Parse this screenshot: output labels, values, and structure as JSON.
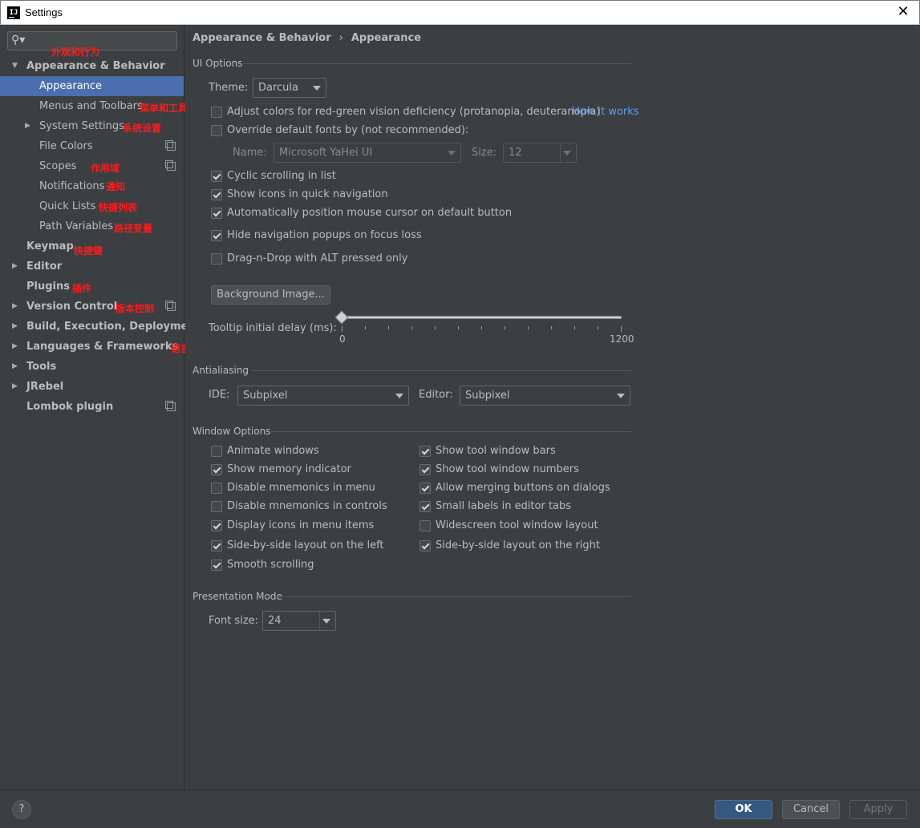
{
  "window": {
    "title": "Settings",
    "app_icon": "IJ"
  },
  "sidebar": {
    "search": {
      "placeholder": "",
      "value": ""
    },
    "items": [
      {
        "label": "Appearance & Behavior",
        "annotation": "外观和行为"
      },
      {
        "label": "Appearance",
        "annotation": ""
      },
      {
        "label": "Menus and Toolbars",
        "annotation": "菜单和工具栏"
      },
      {
        "label": "System Settings",
        "annotation": "系统设置"
      },
      {
        "label": "File Colors",
        "annotation": ""
      },
      {
        "label": "Scopes",
        "annotation": "作用域"
      },
      {
        "label": "Notifications",
        "annotation": "通知"
      },
      {
        "label": "Quick Lists",
        "annotation": "快捷列表"
      },
      {
        "label": "Path Variables",
        "annotation": "路径变量"
      },
      {
        "label": "Keymap",
        "annotation": "快捷键"
      },
      {
        "label": "Editor",
        "annotation": ""
      },
      {
        "label": "Plugins",
        "annotation": "插件"
      },
      {
        "label": "Version Control",
        "annotation": "版本控制"
      },
      {
        "label": "Build, Execution, Deployment",
        "annotation": ""
      },
      {
        "label": "Languages & Frameworks",
        "annotation": "语言和框架"
      },
      {
        "label": "Tools",
        "annotation": ""
      },
      {
        "label": "JRebel",
        "annotation": ""
      },
      {
        "label": "Lombok plugin",
        "annotation": ""
      }
    ]
  },
  "breadcrumb": {
    "parent": "Appearance & Behavior",
    "separator": "›",
    "current": "Appearance"
  },
  "ui_options": {
    "title": "UI Options",
    "theme_label": "Theme:",
    "theme_value": "Darcula",
    "adjust_colors": {
      "label": "Adjust colors for red-green vision deficiency (protanopia, deuteranopia)",
      "checked": false
    },
    "how_it_works": "How it works",
    "override_fonts": {
      "label": "Override default fonts by (not recommended):",
      "checked": false
    },
    "name_label": "Name:",
    "name_value": "Microsoft YaHei UI",
    "size_label": "Size:",
    "size_value": "12",
    "cyclic_scrolling": {
      "label": "Cyclic scrolling in list",
      "checked": true
    },
    "show_icons_quick_nav": {
      "label": "Show icons in quick navigation",
      "checked": true
    },
    "auto_position_cursor": {
      "label": "Automatically position mouse cursor on default button",
      "checked": true
    },
    "hide_nav_popups": {
      "label": "Hide navigation popups on focus loss",
      "checked": true
    },
    "drag_n_drop_alt": {
      "label": "Drag-n-Drop with ALT pressed only",
      "checked": false
    },
    "background_image_button": "Background Image...",
    "tooltip_delay_label": "Tooltip initial delay (ms):",
    "tooltip_delay": {
      "min": "0",
      "max": "1200",
      "value": 0
    }
  },
  "antialiasing": {
    "title": "Antialiasing",
    "ide_label": "IDE:",
    "ide_value": "Subpixel",
    "editor_label": "Editor:",
    "editor_value": "Subpixel"
  },
  "window_options": {
    "title": "Window Options",
    "left": [
      {
        "label": "Animate windows",
        "checked": false
      },
      {
        "label": "Show memory indicator",
        "checked": true
      },
      {
        "label": "Disable mnemonics in menu",
        "checked": false
      },
      {
        "label": "Disable mnemonics in controls",
        "checked": false
      },
      {
        "label": "Display icons in menu items",
        "checked": true
      },
      {
        "label": "Side-by-side layout on the left",
        "checked": true
      },
      {
        "label": "Smooth scrolling",
        "checked": true
      }
    ],
    "right": [
      {
        "label": "Show tool window bars",
        "checked": true
      },
      {
        "label": "Show tool window numbers",
        "checked": true
      },
      {
        "label": "Allow merging buttons on dialogs",
        "checked": true
      },
      {
        "label": "Small labels in editor tabs",
        "checked": true
      },
      {
        "label": "Widescreen tool window layout",
        "checked": false
      },
      {
        "label": "Side-by-side layout on the right",
        "checked": true
      }
    ]
  },
  "presentation_mode": {
    "title": "Presentation Mode",
    "font_size_label": "Font size:",
    "font_size_value": "24"
  },
  "footer": {
    "help": "?",
    "ok": "OK",
    "cancel": "Cancel",
    "apply": "Apply"
  },
  "colors": {
    "background": "#3c3f41",
    "selection": "#4b6eaf",
    "link": "#589df6",
    "annotation": "#ff1a1a",
    "primary_button": "#365880"
  }
}
